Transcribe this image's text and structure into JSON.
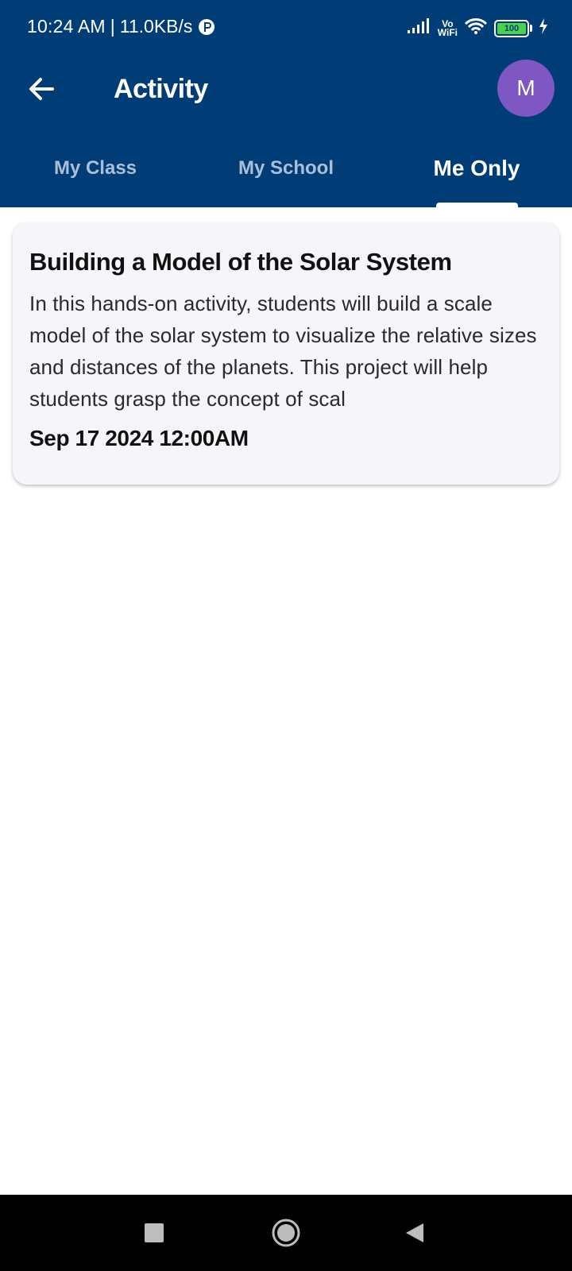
{
  "status_bar": {
    "time": "10:24 AM",
    "separator": "|",
    "speed": "11.0KB/s",
    "vowifi_top": "Vo",
    "vowifi_bottom": "WiFi",
    "battery": "100"
  },
  "toolbar": {
    "title": "Activity",
    "avatar_initial": "M",
    "back_icon": "arrow-left-icon"
  },
  "tabs": [
    {
      "label": "My Class",
      "active": false
    },
    {
      "label": "My School",
      "active": false
    },
    {
      "label": "Me Only",
      "active": true
    }
  ],
  "activities": [
    {
      "title": "Building a Model of the Solar System",
      "description": "In this hands-on activity, students will build a scale model of the solar system to visualize the relative sizes and distances of the planets. This project will help students grasp the concept of scal",
      "date": "Sep 17 2024 12:00AM"
    }
  ],
  "colors": {
    "header_bg": "#003d77",
    "avatar_bg": "#7e57c2",
    "card_bg": "#f5f5fa",
    "tab_inactive": "#aac0d8"
  },
  "nav_bar": {
    "icons": [
      "recents-square-icon",
      "home-circle-icon",
      "back-triangle-icon"
    ]
  }
}
